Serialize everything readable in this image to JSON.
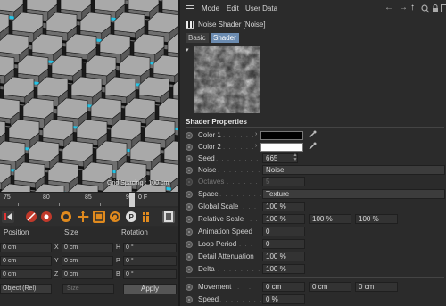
{
  "viewport": {
    "grid_spacing_label": "Grid Spacing : 100 cm"
  },
  "timeline": {
    "ticks": [
      "75",
      "80",
      "85",
      "90"
    ],
    "current_frame": "0 F"
  },
  "coordinates": {
    "headers": {
      "position": "Position",
      "size": "Size",
      "rotation": "Rotation"
    },
    "rows": [
      {
        "pos_value": "0 cm",
        "pos_axis": "X",
        "size_value": "0 cm",
        "size_axis": "H",
        "rot_value": "0 °"
      },
      {
        "pos_value": "0 cm",
        "pos_axis": "Y",
        "size_value": "0 cm",
        "size_axis": "P",
        "rot_value": "0 °"
      },
      {
        "pos_value": "0 cm",
        "pos_axis": "Z",
        "size_value": "0 cm",
        "size_axis": "B",
        "rot_value": "0 °"
      }
    ],
    "mode": "Object (Rel)",
    "size_mode": "Size",
    "apply_label": "Apply"
  },
  "panel": {
    "menu": {
      "mode": "Mode",
      "edit": "Edit",
      "user_data": "User Data"
    },
    "object_title": "Noise Shader [Noise]",
    "tabs": {
      "basic": "Basic",
      "shader": "Shader"
    },
    "section_title": "Shader Properties",
    "colors": {
      "color1": "#000000",
      "color2": "#ffffff",
      "tab_active": "#6b8bb0",
      "accent_cyan": "#25c4e6"
    },
    "params": {
      "color1_label": "Color 1",
      "color2_label": "Color 2",
      "seed_label": "Seed",
      "seed_value": "665",
      "noise_label": "Noise",
      "noise_value": "Noise",
      "octaves_label": "Octaves",
      "octaves_value": "5",
      "space_label": "Space",
      "space_value": "Texture",
      "global_scale_label": "Global Scale",
      "global_scale_value": "100 %",
      "relative_scale_label": "Relative Scale",
      "relative_scale_values": [
        "100 %",
        "100 %",
        "100 %"
      ],
      "animation_speed_label": "Animation Speed",
      "animation_speed_value": "0",
      "loop_period_label": "Loop Period",
      "loop_period_value": "0",
      "detail_attenuation_label": "Detail Attenuation",
      "detail_attenuation_value": "100 %",
      "delta_label": "Delta",
      "delta_value": "100 %",
      "movement_label": "Movement",
      "movement_values": [
        "0 cm",
        "0 cm",
        "0 cm"
      ],
      "speed_label": "Speed",
      "speed_value": "0 %"
    }
  }
}
